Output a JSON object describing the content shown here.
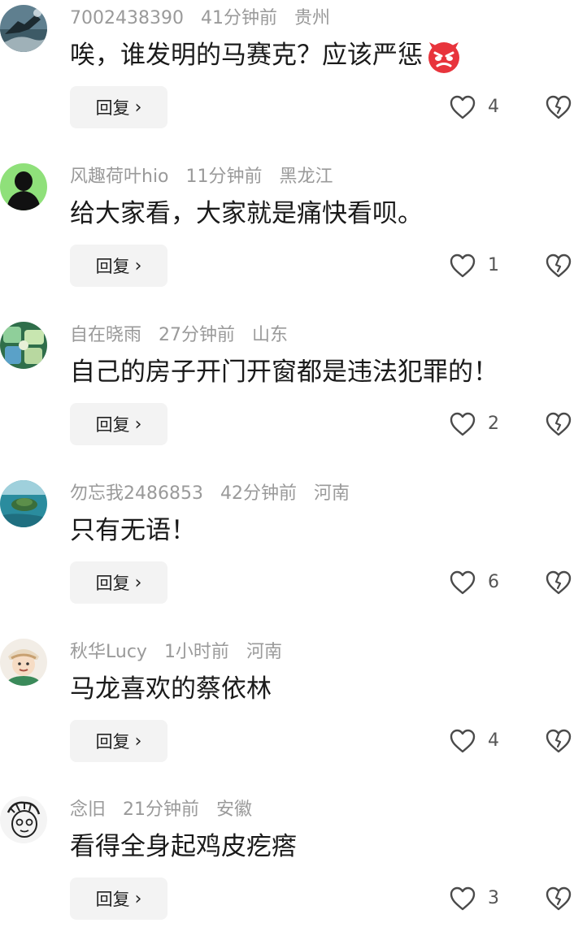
{
  "reply_label": "回复",
  "colors": {
    "meta": "#9a9a9a",
    "text": "#1a1a1a",
    "reply_bg": "#f3f3f3",
    "icon": "#4a4a4a"
  },
  "comments": [
    {
      "username": "7002438390",
      "time": "41分钟前",
      "location": "贵州",
      "text": "唉，谁发明的马赛克？应该严惩",
      "emoji": "angry-face-emoji",
      "likes": "4",
      "avatar": "ocean-splash-avatar"
    },
    {
      "username": "风趣荷叶hio",
      "time": "11分钟前",
      "location": "黑龙江",
      "text": "给大家看，大家就是痛快看呗。",
      "likes": "1",
      "avatar": "black-silhouette-avatar"
    },
    {
      "username": "自在晓雨",
      "time": "27分钟前",
      "location": "山东",
      "text": "自己的房子开门开窗都是违法犯罪的！",
      "likes": "2",
      "avatar": "green-pattern-avatar"
    },
    {
      "username": "勿忘我2486853",
      "time": "42分钟前",
      "location": "河南",
      "text": "只有无语！",
      "likes": "6",
      "avatar": "lake-island-avatar"
    },
    {
      "username": "秋华Lucy",
      "time": "1小时前",
      "location": "河南",
      "text": "马龙喜欢的蔡依林",
      "likes": "4",
      "avatar": "cartoon-person-avatar"
    },
    {
      "username": "念旧",
      "time": "21分钟前",
      "location": "安徽",
      "text": "看得全身起鸡皮疙瘩",
      "likes": "3",
      "avatar": "sketch-face-avatar"
    }
  ]
}
